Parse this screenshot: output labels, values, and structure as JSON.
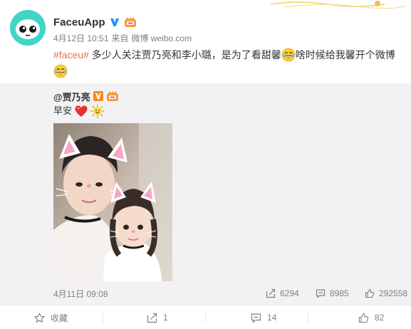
{
  "post": {
    "author": "FaceuApp",
    "date": "4月12日 10:51",
    "source_prefix": "来自",
    "source": "微博 weibo.com",
    "hashtag": "#faceu#",
    "text_part1": " 多少人关注贾乃亮和李小璐，是为了看甜馨",
    "text_part2": "啥时候给我馨开个微博"
  },
  "repost": {
    "author": "@贾乃亮",
    "text": "早安",
    "date": "4月11日 09:08",
    "forward_count": "6294",
    "comment_count": "8985",
    "like_count": "292558"
  },
  "actions": {
    "favorite_label": "收藏",
    "forward_count": "1",
    "comment_count": "14",
    "like_count": "82"
  },
  "colors": {
    "hashtag": "#eb7350",
    "avatar": "#3fd6c6",
    "verified": "#1e90ff",
    "repost_bg": "#f2f2f5"
  },
  "icons": [
    "faceu-logo-icon",
    "verified-icon",
    "vip-icon",
    "laughing-emoji-icon",
    "heart-emoji-icon",
    "sun-emoji-icon",
    "forward-icon",
    "comment-icon",
    "like-icon",
    "star-icon"
  ]
}
